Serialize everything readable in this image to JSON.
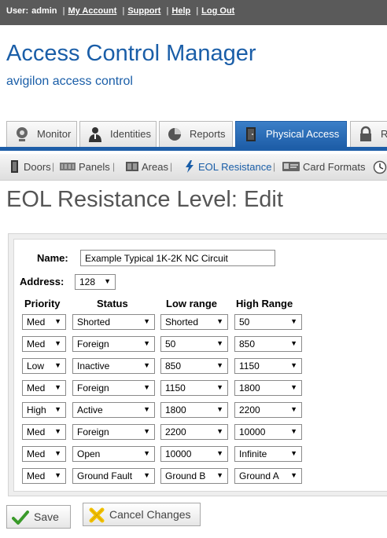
{
  "topbar": {
    "user_label": "User:",
    "user_name": "admin",
    "links": [
      "My Account",
      "Support",
      "Help",
      "Log Out"
    ]
  },
  "header": {
    "title": "Access Control Manager",
    "subtitle": "avigilon access control"
  },
  "tabs": [
    {
      "label": "Monitor",
      "icon": "camera-icon"
    },
    {
      "label": "Identities",
      "icon": "person-icon"
    },
    {
      "label": "Reports",
      "icon": "pie-chart-icon"
    },
    {
      "label": "Physical Access",
      "icon": "door-icon",
      "active": true
    },
    {
      "label": "R",
      "icon": "lock-icon"
    }
  ],
  "subnav": [
    {
      "label": "Doors",
      "icon": "door-icon"
    },
    {
      "label": "Panels",
      "icon": "panel-icon"
    },
    {
      "label": "Areas",
      "icon": "area-icon"
    },
    {
      "label": "EOL Resistance",
      "icon": "lightning-icon",
      "active": true
    },
    {
      "label": "Card Formats",
      "icon": "card-icon"
    }
  ],
  "page": {
    "title": "EOL Resistance Level: Edit"
  },
  "form": {
    "name_label": "Name:",
    "name_value": "Example Typical 1K-2K NC Circuit",
    "address_label": "Address:",
    "address_value": "128",
    "columns": [
      "Priority",
      "Status",
      "Low range",
      "High Range"
    ],
    "rows": [
      {
        "priority": "Med",
        "status": "Shorted",
        "low": "Shorted",
        "high": "50"
      },
      {
        "priority": "Med",
        "status": "Foreign",
        "low": "50",
        "high": "850"
      },
      {
        "priority": "Low",
        "status": "Inactive",
        "low": "850",
        "high": "1150"
      },
      {
        "priority": "Med",
        "status": "Foreign",
        "low": "1150",
        "high": "1800"
      },
      {
        "priority": "High",
        "status": "Active",
        "low": "1800",
        "high": "2200"
      },
      {
        "priority": "Med",
        "status": "Foreign",
        "low": "2200",
        "high": "10000"
      },
      {
        "priority": "Med",
        "status": "Open",
        "low": "10000",
        "high": "Infinite"
      },
      {
        "priority": "Med",
        "status": "Ground Fault",
        "low": "Ground B",
        "high": "Ground A"
      }
    ]
  },
  "actions": {
    "save_label": "Save",
    "cancel_label": "Cancel Changes"
  },
  "colors": {
    "brand_blue": "#1a5ea8",
    "topbar_gray": "#5a5a5a",
    "save_check_green": "#3a9a2a",
    "cancel_x_yellow": "#f2c200"
  }
}
